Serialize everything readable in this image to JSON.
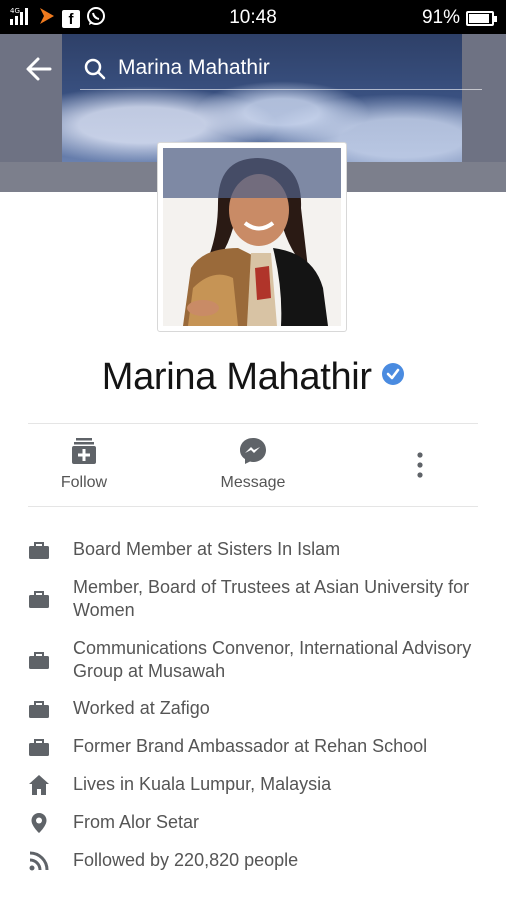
{
  "status_bar": {
    "network_label": "4G",
    "time": "10:48",
    "battery_percent_label": "91%",
    "battery_level": 0.91,
    "icons": [
      "signal-icon",
      "app-notification-icon",
      "facebook-icon",
      "whatsapp-icon",
      "battery-icon"
    ]
  },
  "search": {
    "query": "Marina Mahathir"
  },
  "profile": {
    "name": "Marina Mahathir",
    "verified": true
  },
  "actions": {
    "follow_label": "Follow",
    "message_label": "Message"
  },
  "about": [
    {
      "icon": "briefcase-icon",
      "text": "Board Member at Sisters In Islam"
    },
    {
      "icon": "briefcase-icon",
      "text": "Member, Board of Trustees at Asian University for Women"
    },
    {
      "icon": "briefcase-icon",
      "text": "Communications Convenor, International Advisory Group at Musawah"
    },
    {
      "icon": "briefcase-icon",
      "text": "Worked at Zafigo"
    },
    {
      "icon": "briefcase-icon",
      "text": "Former Brand Ambassador at Rehan School"
    },
    {
      "icon": "home-icon",
      "text": "Lives in Kuala Lumpur, Malaysia"
    },
    {
      "icon": "location-pin-icon",
      "text": "From Alor Setar"
    },
    {
      "icon": "rss-icon",
      "text": "Followed by 220,820 people"
    }
  ],
  "colors": {
    "accent": "#4a8be0",
    "icon_gray": "#5f6368",
    "text_gray": "#555555"
  }
}
